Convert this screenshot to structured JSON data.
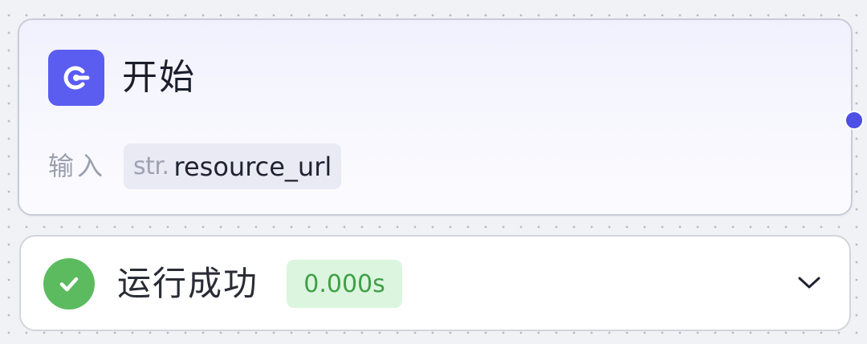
{
  "start_node": {
    "title": "开始",
    "icon": "start-node-icon",
    "input_label": "输入",
    "variable": {
      "type": "str.",
      "name": "resource_url"
    },
    "accent_color": "#5a5df0"
  },
  "run_result": {
    "status": "运行成功",
    "duration": "0.000s",
    "status_icon": "check-circle-icon",
    "toggle_icon": "chevron-down-icon",
    "status_color": "#5cbb5f"
  }
}
